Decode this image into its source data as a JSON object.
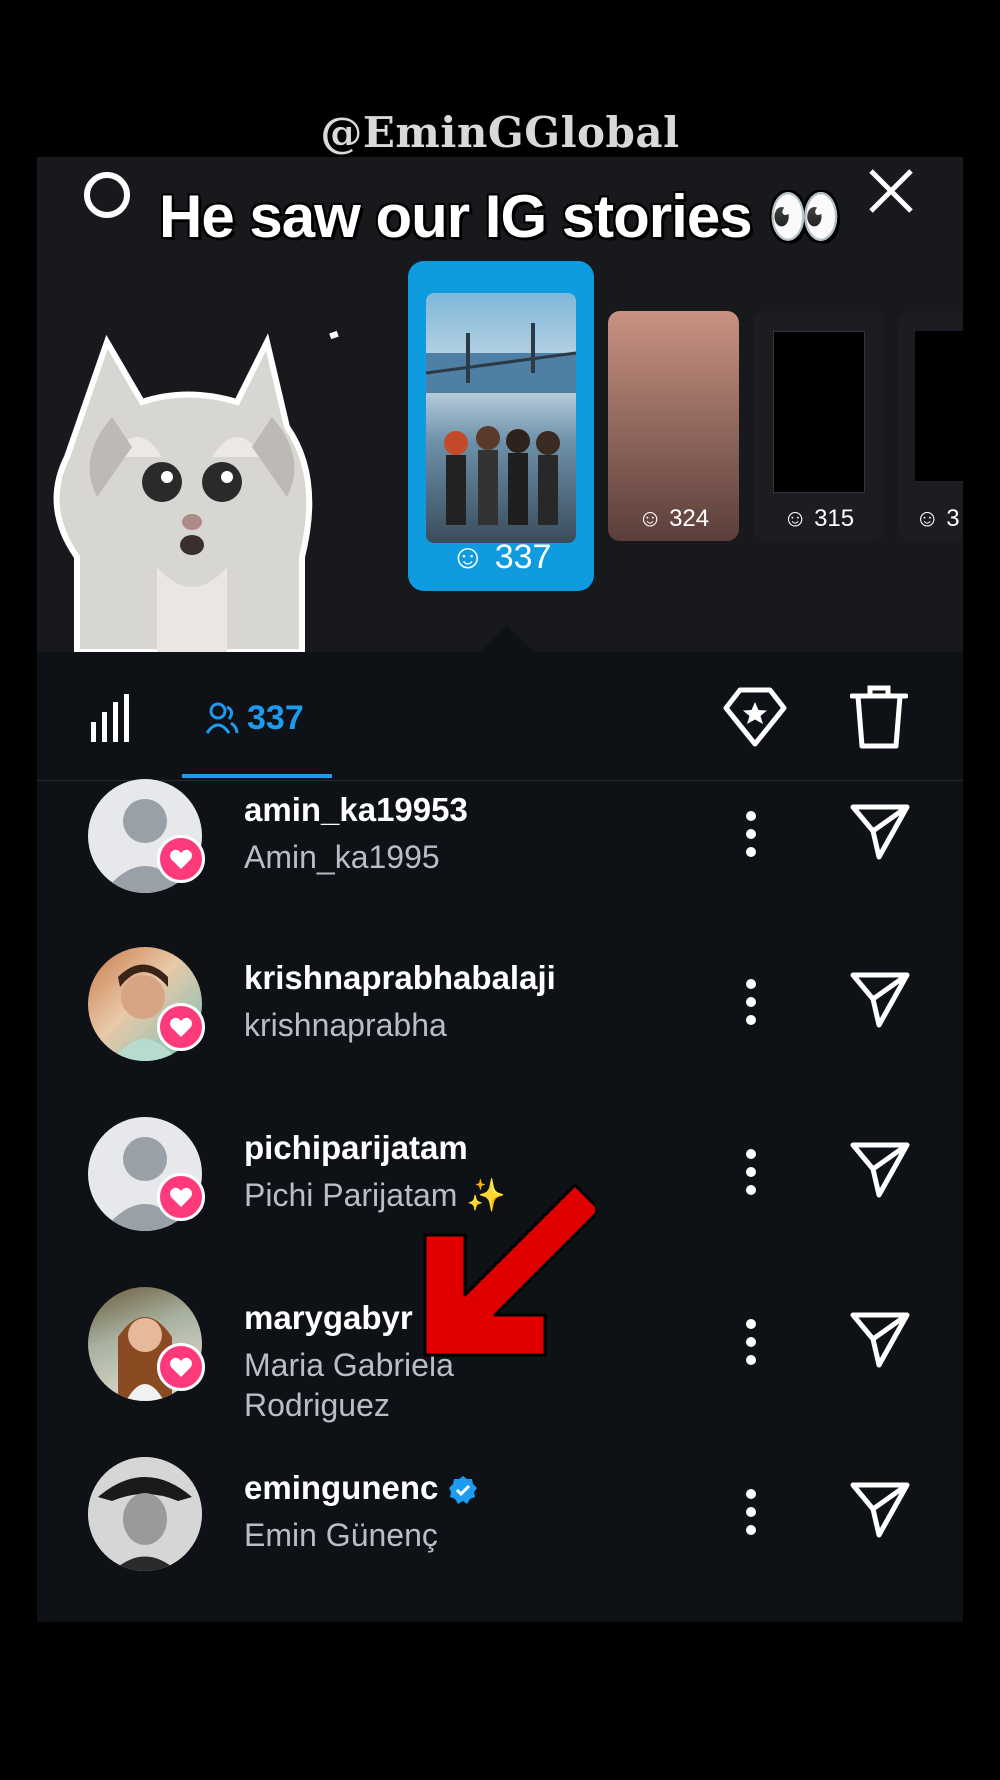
{
  "watermark": "@EminGGlobal",
  "caption": "He saw our IG stories 👀",
  "stories": [
    {
      "count": "337",
      "selected": true
    },
    {
      "count": "324"
    },
    {
      "count": "315"
    },
    {
      "count": "3"
    }
  ],
  "tabs": {
    "viewers_count": "337"
  },
  "viewers": [
    {
      "username": "amin_ka19953",
      "full_name": "Amin_ka1995",
      "liked": true,
      "avatar": "default"
    },
    {
      "username": "krishnaprabhabalaji",
      "full_name": "krishnaprabha",
      "liked": true,
      "avatar": "photo"
    },
    {
      "username": "pichiparijatam",
      "full_name": "Pichi Parijatam ✨",
      "liked": true,
      "avatar": "default"
    },
    {
      "username": "marygabyr",
      "full_name": "Maria Gabriela Rodriguez",
      "liked": true,
      "avatar": "photo"
    },
    {
      "username": "emingunenc",
      "full_name": "Emin Günenç",
      "liked": false,
      "verified": true,
      "avatar": "photo"
    }
  ],
  "colors": {
    "accent": "#1d9bf0",
    "like": "#ff3a7a",
    "panel": "#0e1116",
    "arrow": "#e00000"
  }
}
